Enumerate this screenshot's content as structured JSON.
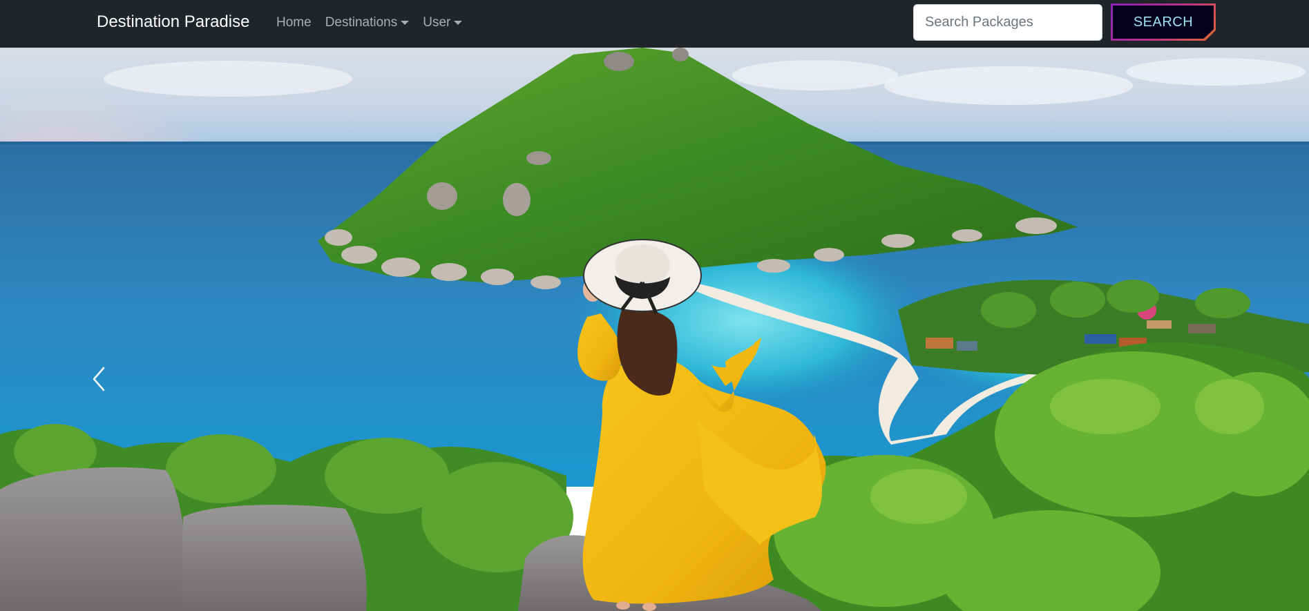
{
  "navbar": {
    "brand": "Destination Paradise",
    "links": [
      {
        "label": "Home",
        "dropdown": false
      },
      {
        "label": "Destinations",
        "dropdown": true
      },
      {
        "label": "User",
        "dropdown": true
      }
    ],
    "search": {
      "placeholder": "Search Packages",
      "value": "",
      "button_label": "SEARCH"
    }
  },
  "hero": {
    "icons": {
      "prev": "chevron-left-icon"
    }
  },
  "colors": {
    "navbar_bg": "#212529",
    "nav_link": "#adb5bd",
    "button_bg": "#03001c",
    "button_text": "#9fe0f5",
    "button_border_gradient": [
      "#8a1fb8",
      "#e06a33"
    ]
  }
}
